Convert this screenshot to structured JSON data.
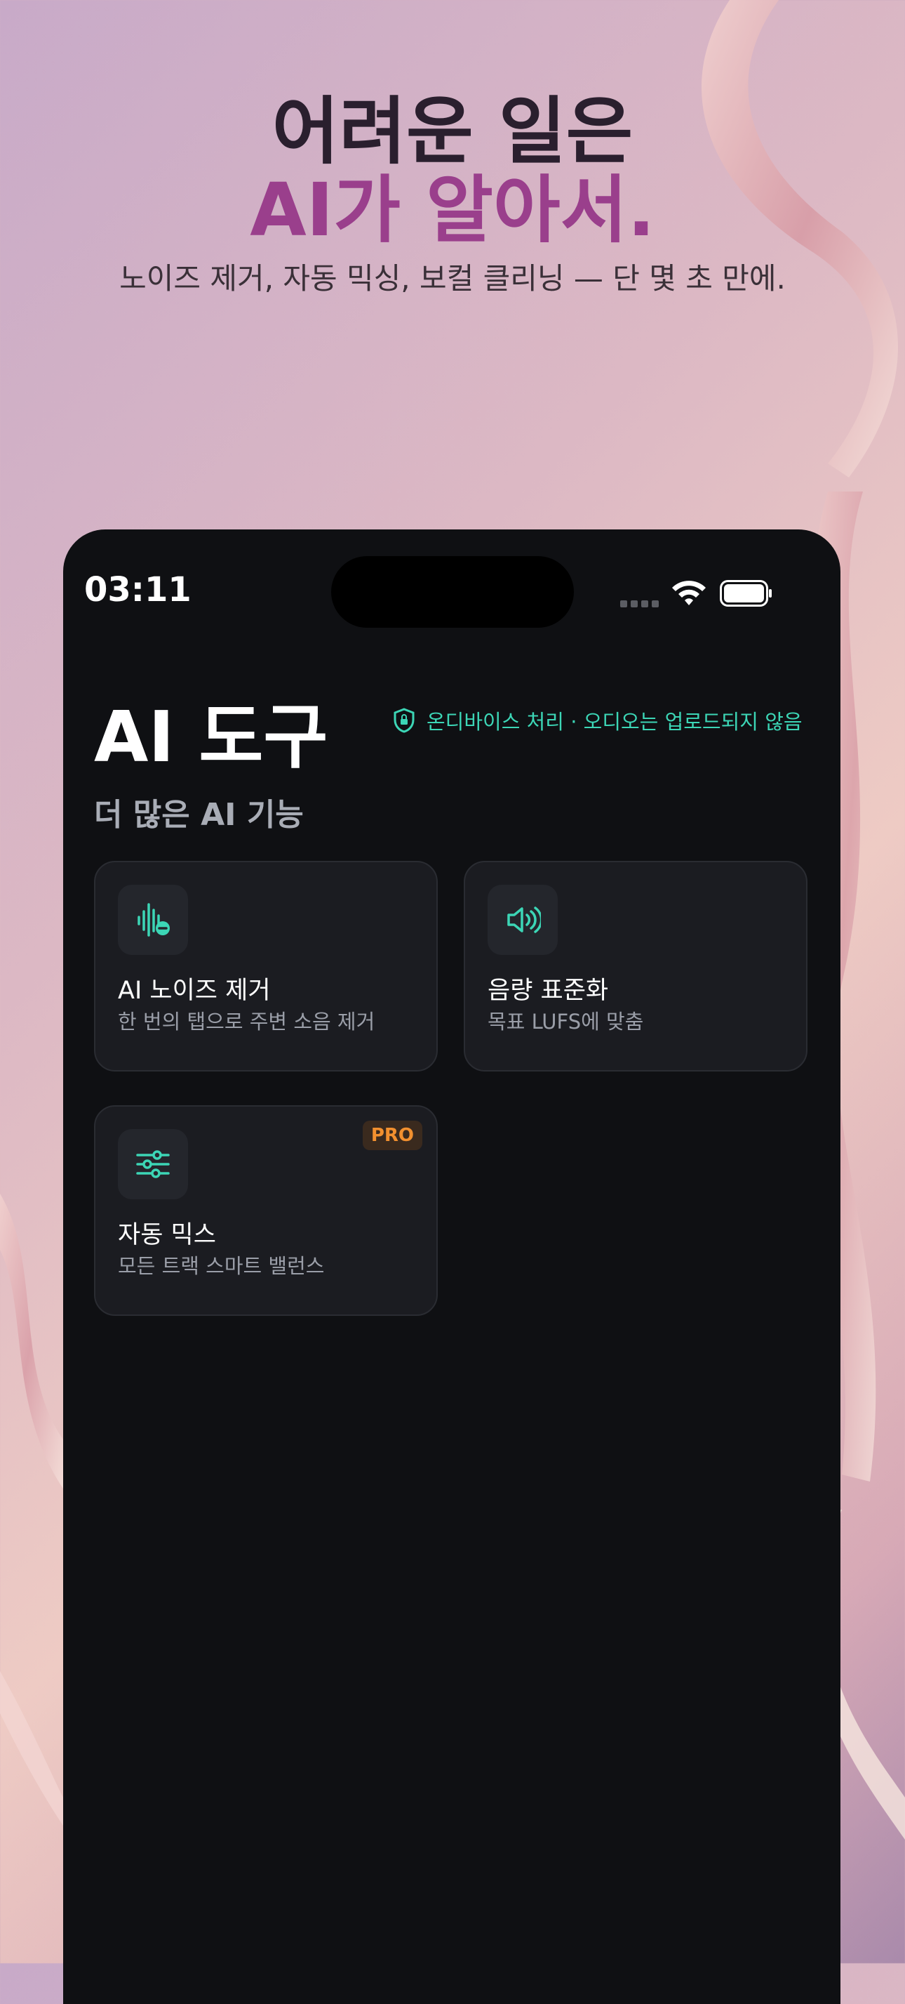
{
  "hero": {
    "line1": "어려운 일은",
    "line2": "AI가 알아서.",
    "subtitle": "노이즈 제거, 자동 믹싱, 보컬 클리닝 — 단 몇 초 만에."
  },
  "status_bar": {
    "time": "03:11",
    "icons": [
      "signal-icon",
      "wifi-icon",
      "battery-icon"
    ]
  },
  "screen": {
    "title": "AI 도구",
    "privacy_note": "온디바이스 처리 · 오디오는 업로드되지 않음",
    "section_title": "더 많은 AI 기능"
  },
  "cards": [
    {
      "title": "AI 노이즈 제거",
      "subtitle": "한 번의 탭으로 주변 소음 제거",
      "icon": "noise-removal-icon"
    },
    {
      "title": "음량 표준화",
      "subtitle": "목표 LUFS에 맞춤",
      "icon": "speaker-volume-icon"
    },
    {
      "title": "자동 믹스",
      "subtitle": "모든 트랙 스마트 밸런스",
      "icon": "sliders-icon",
      "badge": "PRO"
    }
  ],
  "colors": {
    "accent_teal": "#3cd6b6",
    "hero_purple": "#9a3f8c",
    "pro_orange": "#f2902f",
    "screen_bg": "#0f1013",
    "card_bg": "#1b1c21"
  }
}
